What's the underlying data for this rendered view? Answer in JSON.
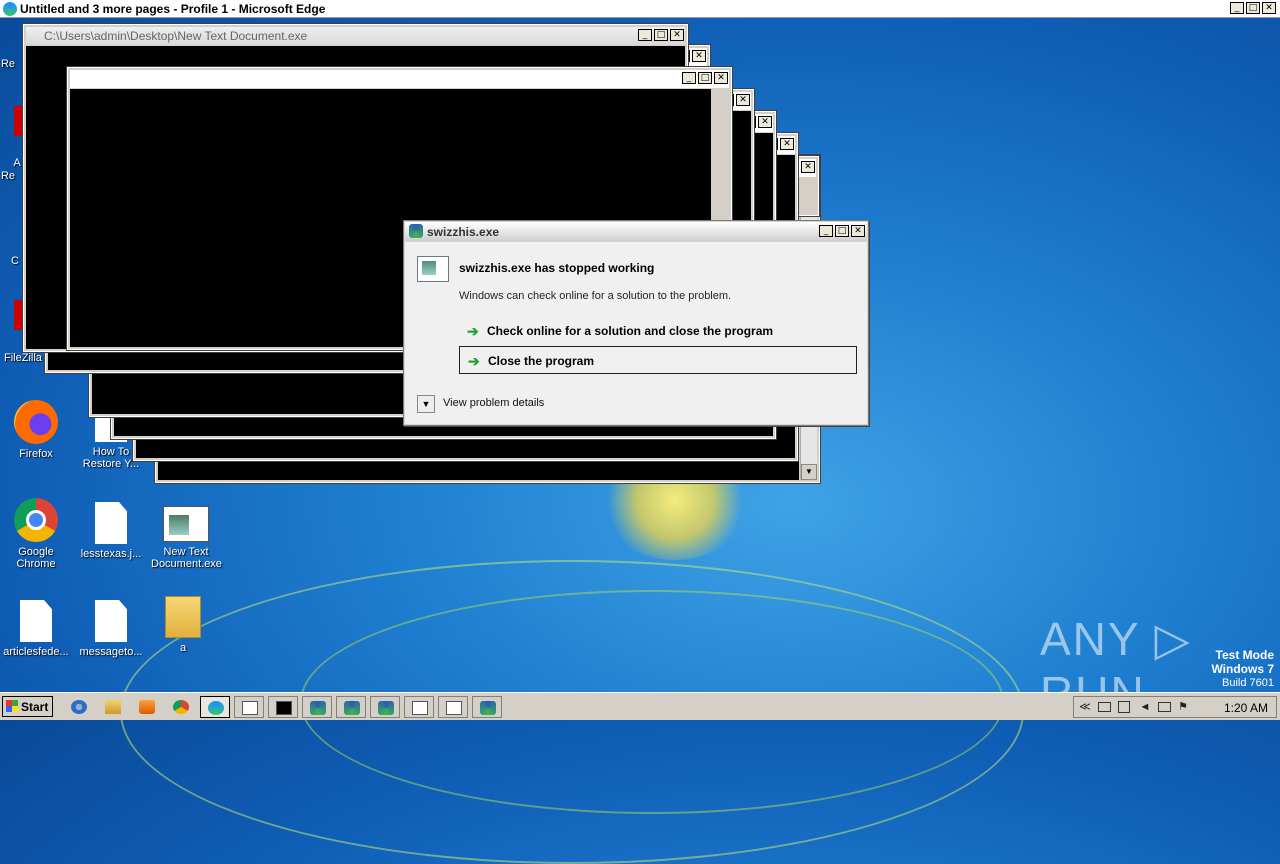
{
  "browser": {
    "title": "Untitled and 3 more pages - Profile 1 - Microsoft Edge",
    "min": "_",
    "max": "□",
    "close": "✕"
  },
  "console_window": {
    "title": "C:\\Users\\admin\\Desktop\\New Text Document.exe"
  },
  "window_controls": {
    "min": "_",
    "max": "□",
    "close": "✕"
  },
  "scroll_glyphs": {
    "up": "▲",
    "down": "▼"
  },
  "dialog": {
    "title": "swizzhis.exe",
    "headline": "swizzhis.exe has stopped working",
    "message": "Windows can check online for a solution to the problem.",
    "option_check": "Check online for a solution and close the program",
    "option_close": "Close the program",
    "details": "View problem details",
    "arrow": "➔",
    "chevron": "▼"
  },
  "desktop_icons": {
    "cut_re1": "Re",
    "cut_a": "A",
    "cut_re2": "Re",
    "cut_c": "C",
    "filezilla": "FileZilla C",
    "firefox": "Firefox",
    "howto": "How To Restore Y...",
    "chrome": "Google Chrome",
    "lesstexas": "lesstexas.j...",
    "newtext": "New Text Document.exe",
    "articles": "articlesfede...",
    "messageto": "messageto...",
    "folder_a": "a"
  },
  "watermark": {
    "brand": "ANY ▷ RUN",
    "line1": "Test Mode",
    "line2": "Windows 7",
    "line3": "Build 7601"
  },
  "taskbar": {
    "start_label": "Start",
    "clock": "1:20 AM",
    "tray_chevron": "≪"
  }
}
